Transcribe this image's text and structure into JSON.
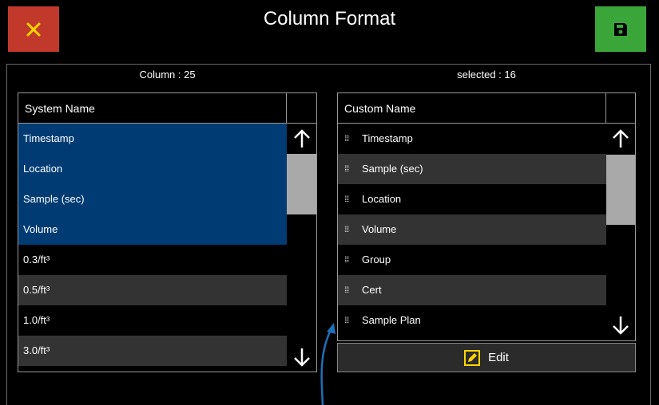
{
  "header": {
    "title": "Column Format",
    "close_icon": "close-icon",
    "save_icon": "floppy-disk-icon"
  },
  "colors": {
    "close": "#c0392b",
    "save": "#3aa63a",
    "accent_yellow": "#ffd600",
    "selected_row": "#003c73",
    "pointer_arrow": "#1f6fb8"
  },
  "left": {
    "count_label": "Column : 25",
    "header": "System Name",
    "items": [
      {
        "label": "Timestamp",
        "state": "sel"
      },
      {
        "label": "Location",
        "state": "sel"
      },
      {
        "label": "Sample (sec)",
        "state": "sel"
      },
      {
        "label": "Volume",
        "state": "sel"
      },
      {
        "label": "0.3/ft³",
        "state": "norm"
      },
      {
        "label": "0.5/ft³",
        "state": "alt"
      },
      {
        "label": "1.0/ft³",
        "state": "norm"
      },
      {
        "label": "3.0/ft³",
        "state": "alt"
      }
    ]
  },
  "right": {
    "count_label": "selected : 16",
    "header": "Custom Name",
    "items": [
      {
        "label": "Timestamp",
        "state": "norm"
      },
      {
        "label": "Sample (sec)",
        "state": "alt"
      },
      {
        "label": "Location",
        "state": "norm"
      },
      {
        "label": "Volume",
        "state": "alt"
      },
      {
        "label": "Group",
        "state": "norm"
      },
      {
        "label": "Cert",
        "state": "alt"
      },
      {
        "label": "Sample Plan",
        "state": "norm"
      }
    ],
    "edit_label": "Edit",
    "edit_icon": "edit-pencil-icon",
    "drag_icon": "drag-handle-icon"
  }
}
